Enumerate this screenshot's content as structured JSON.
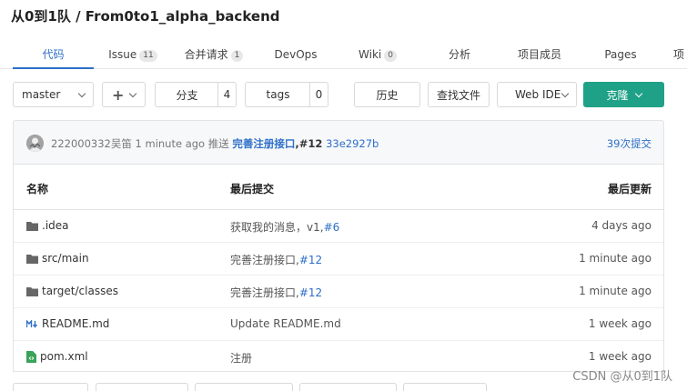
{
  "repo": {
    "title": "从0到1队 / From0to1_alpha_backend"
  },
  "tabs": [
    {
      "label": "代码",
      "count": null
    },
    {
      "label": "Issue",
      "count": "11"
    },
    {
      "label": "合并请求",
      "count": "1"
    },
    {
      "label": "DevOps",
      "count": null
    },
    {
      "label": "Wiki",
      "count": "0"
    },
    {
      "label": "分析",
      "count": null
    },
    {
      "label": "项目成员",
      "count": null
    },
    {
      "label": "Pages",
      "count": null
    },
    {
      "label": "项",
      "count": null
    }
  ],
  "toolbar": {
    "branch": "master",
    "add": "+",
    "branches_label": "分支",
    "branches_count": "4",
    "tags_label": "tags",
    "tags_count": "0",
    "history": "历史",
    "find_file": "查找文件",
    "web_ide": "Web IDE",
    "clone": "克隆"
  },
  "last_commit": {
    "author": "222000332吴笛",
    "time": "1 minute ago",
    "action": "推送",
    "message": "完善注册接口",
    "issue": ",#12",
    "sha": "33e2927b",
    "commit_count": "39次提交"
  },
  "table": {
    "headers": {
      "name": "名称",
      "commit": "最后提交",
      "updated": "最后更新"
    },
    "rows": [
      {
        "icon": "folder-icon",
        "name": ".idea",
        "commit": "获取我的消息，v1,",
        "ref": "#6",
        "updated": "4 days ago"
      },
      {
        "icon": "folder-icon",
        "name": "src/main",
        "commit": "完善注册接口,",
        "ref": "#12",
        "updated": "1 minute ago"
      },
      {
        "icon": "folder-icon",
        "name": "target/classes",
        "commit": "完善注册接口,",
        "ref": "#12",
        "updated": "1 minute ago"
      },
      {
        "icon": "markdown-icon",
        "name": "README.md",
        "commit": "Update README.md",
        "ref": "",
        "updated": "1 week ago"
      },
      {
        "icon": "file-icon",
        "name": "pom.xml",
        "commit": "注册",
        "ref": "",
        "updated": "1 week ago"
      }
    ]
  },
  "watermark": "CSDN @从0到1队",
  "colors": {
    "accent": "#2e6fc9",
    "clone": "#1fa187"
  }
}
